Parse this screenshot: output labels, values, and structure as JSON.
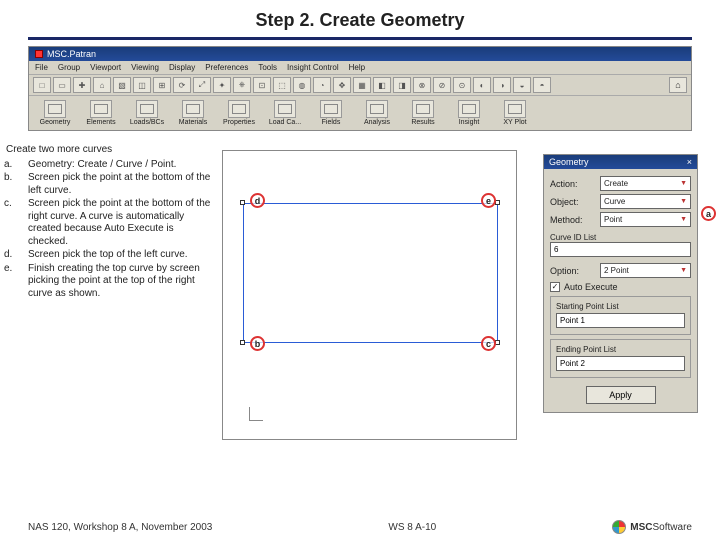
{
  "title": "Step 2. Create Geometry",
  "app": {
    "name": "MSC.Patran",
    "menus": [
      "File",
      "Group",
      "Viewport",
      "Viewing",
      "Display",
      "Preferences",
      "Tools",
      "Insight Control",
      "Help"
    ],
    "bigButtons": [
      "Geometry",
      "Elements",
      "Loads/BCs",
      "Materials",
      "Properties",
      "Load Ca...",
      "Fields",
      "Analysis",
      "Results",
      "Insight",
      "XY Plot"
    ]
  },
  "instructions": {
    "lead": "Create two more curves",
    "items": [
      {
        "l": "a.",
        "t": "Geometry: Create / Curve / Point."
      },
      {
        "l": "b.",
        "t": "Screen pick the point at the bottom of the left curve."
      },
      {
        "l": "c.",
        "t": "Screen pick the point at the bottom of the right curve.  A curve is automatically created because Auto Execute is checked."
      },
      {
        "l": "d.",
        "t": "Screen pick the top of the left curve."
      },
      {
        "l": "e.",
        "t": "Finish creating the top curve by screen picking the point at the top of the right curve as shown."
      }
    ]
  },
  "viewport": {
    "annos": {
      "d": "d",
      "e": "e",
      "b": "b",
      "c": "c"
    }
  },
  "panel": {
    "title": "Geometry",
    "action_l": "Action:",
    "action_v": "Create",
    "object_l": "Object:",
    "object_v": "Curve",
    "method_l": "Method:",
    "method_v": "Point",
    "curveid_l": "Curve ID List",
    "curveid_v": "6",
    "option_l": "Option:",
    "option_v": "2 Point",
    "autoexec": "Auto Execute",
    "sp_l": "Starting Point List",
    "sp_v": "Point 1",
    "ep_l": "Ending Point List",
    "ep_v": "Point 2",
    "apply": "Apply"
  },
  "anno_a": "a",
  "footer": {
    "left": "NAS 120, Workshop 8 A, November 2003",
    "center": "WS 8 A-10",
    "logo_top": "MSC",
    "logo_bottom": "Software"
  }
}
